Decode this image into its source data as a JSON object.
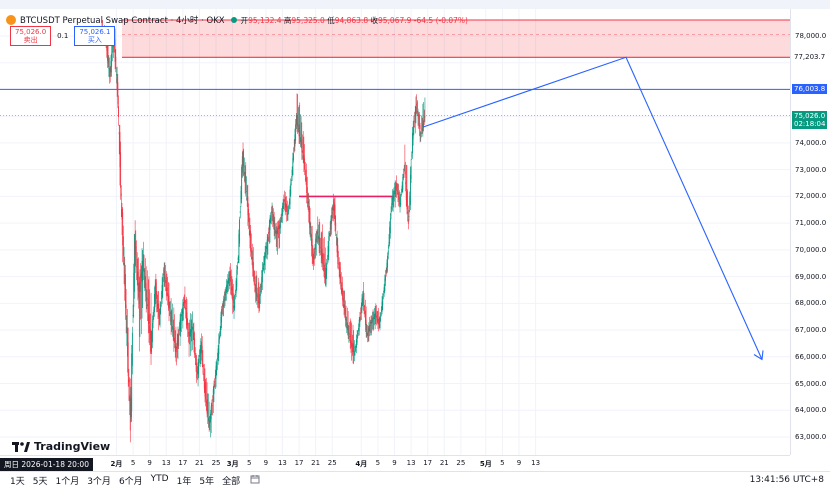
{
  "header": {
    "symbol": "BTCUSDT Perpetual Swap Contract · 4小时 · OKX",
    "ohlc": {
      "open_label": "开",
      "open": "95,132.4",
      "high_label": "高",
      "high": "95,325.0",
      "low_label": "低",
      "low": "94,863.8",
      "close_label": "收",
      "close": "95,067.9",
      "change": "-64.5 (-0.07%)"
    },
    "sell": {
      "price": "75,026.0",
      "label": "卖出"
    },
    "spread": "0.1",
    "buy": {
      "price": "75,026.1",
      "label": "买入"
    }
  },
  "price_axis": {
    "ticks": [
      "78,000.0",
      "77,000.0",
      "76,000.0",
      "75,000.0",
      "74,000.0",
      "73,000.0",
      "72,000.0",
      "71,000.0",
      "70,000.0",
      "69,000.0",
      "68,000.0",
      "67,000.0",
      "66,000.0",
      "65,000.0",
      "64,000.0",
      "63,000.0"
    ],
    "tag_zone_top": "77,203.7",
    "tag_resistance": "76,003.8",
    "tag_last": "75,026.0",
    "tag_countdown": "02:18:04",
    "colors": {
      "zone": "#f23645",
      "line": "#2962ff",
      "last": "#089981"
    }
  },
  "time_axis": {
    "period_label": "周日 2026-01-18  20:00",
    "ticks": [
      "2月",
      "5",
      "9",
      "13",
      "17",
      "21",
      "25",
      "3月",
      "5",
      "9",
      "13",
      "17",
      "21",
      "25",
      "4月",
      "5",
      "9",
      "13",
      "17",
      "21",
      "25",
      "5月",
      "5",
      "9",
      "13"
    ]
  },
  "bottom_bar": {
    "timeframes": [
      "1天",
      "5天",
      "1个月",
      "3个月",
      "6个月",
      "YTD",
      "1年",
      "5年",
      "全部"
    ],
    "calendar_icon": "calendar-icon",
    "clock": "13:41:56 UTC+8"
  },
  "brand": {
    "name": "TradingView",
    "logo_icon": "tradingview-logo-icon"
  },
  "chart_data": {
    "type": "candlestick",
    "symbol": "BTCUSDT Perpetual Swap Contract",
    "interval": "4小时",
    "exchange": "OKX",
    "y_range": [
      62500,
      79000
    ],
    "x_range": [
      "2026-01-29",
      "2026-05-14"
    ],
    "candles": [
      [
        "01-29",
        78300,
        78600,
        77600,
        77900
      ],
      [
        "01-30",
        77900,
        78500,
        76200,
        76500
      ],
      [
        "01-31",
        76500,
        78300,
        76100,
        78000
      ],
      [
        "02-01",
        78000,
        78400,
        75300,
        75600
      ],
      [
        "02-02",
        75600,
        76000,
        70200,
        71000
      ],
      [
        "02-03",
        71000,
        71600,
        66800,
        67500
      ],
      [
        "02-04",
        67500,
        68200,
        62800,
        63500
      ],
      [
        "02-05",
        63500,
        70600,
        63100,
        70200
      ],
      [
        "02-06",
        70200,
        71200,
        67800,
        68300
      ],
      [
        "02-07",
        68300,
        70100,
        66200,
        69600
      ],
      [
        "02-08",
        69600,
        70300,
        67500,
        68100
      ],
      [
        "02-09",
        68100,
        69600,
        65700,
        66400
      ],
      [
        "02-10",
        66400,
        68900,
        66100,
        68600
      ],
      [
        "02-11",
        68600,
        69100,
        66900,
        67400
      ],
      [
        "02-12",
        67400,
        69500,
        67100,
        69200
      ],
      [
        "02-13",
        69200,
        69800,
        67900,
        68300
      ],
      [
        "02-14",
        68300,
        68800,
        66700,
        67200
      ],
      [
        "02-15",
        67200,
        68100,
        65800,
        66200
      ],
      [
        "02-16",
        66200,
        67600,
        65600,
        67300
      ],
      [
        "02-17",
        67300,
        68400,
        66700,
        68200
      ],
      [
        "02-18",
        68200,
        68700,
        66400,
        66800
      ],
      [
        "02-19",
        66800,
        67700,
        66000,
        67100
      ],
      [
        "02-20",
        67100,
        67500,
        65000,
        65300
      ],
      [
        "02-21",
        65300,
        66700,
        64800,
        66500
      ],
      [
        "02-22",
        66500,
        67000,
        64300,
        64600
      ],
      [
        "02-23",
        64600,
        65500,
        63100,
        63400
      ],
      [
        "02-24",
        63400,
        64900,
        62800,
        64700
      ],
      [
        "02-25",
        64700,
        66200,
        64300,
        66000
      ],
      [
        "02-26",
        66000,
        67900,
        65700,
        67700
      ],
      [
        "02-27",
        67700,
        68700,
        67300,
        68500
      ],
      [
        "02-28",
        68500,
        69400,
        68100,
        69100
      ],
      [
        "03-01",
        69100,
        69600,
        67300,
        67800
      ],
      [
        "03-02",
        67800,
        70000,
        67600,
        69800
      ],
      [
        "03-03",
        69800,
        73700,
        69600,
        73500
      ],
      [
        "03-04",
        73500,
        74100,
        71700,
        72100
      ],
      [
        "03-05",
        72100,
        72600,
        69700,
        70100
      ],
      [
        "03-06",
        70100,
        70700,
        68300,
        68600
      ],
      [
        "03-07",
        68600,
        69300,
        67600,
        68000
      ],
      [
        "03-08",
        68000,
        69700,
        67700,
        69400
      ],
      [
        "03-09",
        69400,
        70600,
        69000,
        70300
      ],
      [
        "03-10",
        70300,
        71700,
        69800,
        71500
      ],
      [
        "03-11",
        71500,
        71900,
        70200,
        70600
      ],
      [
        "03-12",
        70600,
        71200,
        69800,
        70900
      ],
      [
        "03-13",
        70900,
        72100,
        70600,
        71900
      ],
      [
        "03-14",
        71900,
        72300,
        70900,
        71300
      ],
      [
        "03-15",
        71300,
        73200,
        71100,
        73000
      ],
      [
        "03-16",
        73000,
        75200,
        72800,
        74900
      ],
      [
        "03-17",
        74900,
        76000,
        73800,
        74100
      ],
      [
        "03-18",
        74100,
        75000,
        72800,
        73100
      ],
      [
        "03-19",
        73100,
        73600,
        71000,
        71400
      ],
      [
        "03-20",
        71400,
        71900,
        69200,
        69600
      ],
      [
        "03-21",
        69600,
        70900,
        69100,
        70700
      ],
      [
        "03-22",
        70700,
        71400,
        69500,
        69900
      ],
      [
        "03-23",
        69900,
        71000,
        68600,
        68900
      ],
      [
        "03-24",
        68900,
        70900,
        68600,
        70700
      ],
      [
        "03-25",
        70700,
        72100,
        70300,
        71800
      ],
      [
        "03-26",
        71800,
        72100,
        69300,
        69600
      ],
      [
        "03-27",
        69600,
        70100,
        68100,
        68400
      ],
      [
        "03-28",
        68400,
        69000,
        67000,
        67300
      ],
      [
        "03-29",
        67300,
        67900,
        66300,
        66600
      ],
      [
        "03-30",
        66600,
        67400,
        65600,
        66100
      ],
      [
        "03-31",
        66100,
        67300,
        65900,
        67100
      ],
      [
        "04-01",
        67100,
        68500,
        66800,
        68300
      ],
      [
        "04-02",
        68300,
        68800,
        66500,
        66800
      ],
      [
        "04-03",
        66800,
        67600,
        66400,
        67300
      ],
      [
        "04-04",
        67300,
        67900,
        66800,
        67600
      ],
      [
        "04-05",
        67600,
        68000,
        66900,
        67200
      ],
      [
        "04-06",
        67200,
        68600,
        67000,
        68400
      ],
      [
        "04-07",
        68400,
        69900,
        68200,
        69700
      ],
      [
        "04-08",
        69700,
        72100,
        69500,
        71800
      ],
      [
        "04-09",
        71800,
        72700,
        71300,
        72400
      ],
      [
        "04-10",
        72400,
        72800,
        71400,
        71700
      ],
      [
        "04-11",
        71700,
        73300,
        71600,
        73100
      ],
      [
        "04-12",
        73100,
        74100,
        70600,
        70900
      ],
      [
        "04-13",
        70900,
        74600,
        70700,
        74300
      ],
      [
        "04-14",
        74300,
        75900,
        73900,
        75500
      ],
      [
        "04-15",
        75500,
        75600,
        73800,
        74300
      ],
      [
        "04-16",
        74300,
        75800,
        74100,
        75026
      ]
    ]
  }
}
